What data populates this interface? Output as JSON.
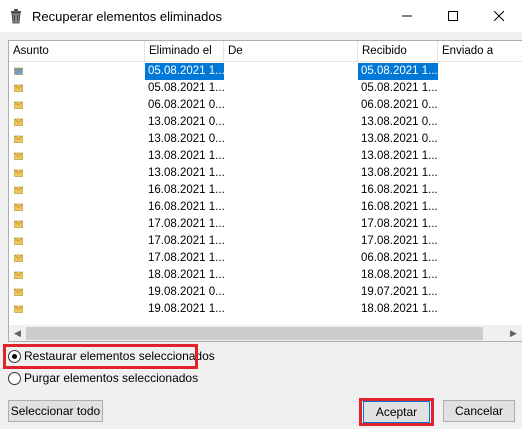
{
  "window": {
    "title": "Recuperar elementos eliminados"
  },
  "columns": [
    "Asunto",
    "Eliminado el",
    "De",
    "Recibido",
    "Enviado a"
  ],
  "rows": [
    {
      "eliminado": "05.08.2021 1...",
      "recibido": "05.08.2021 1...",
      "selected": true
    },
    {
      "eliminado": "05.08.2021 1...",
      "recibido": "05.08.2021 1..."
    },
    {
      "eliminado": "06.08.2021 0...",
      "recibido": "06.08.2021 0..."
    },
    {
      "eliminado": "13.08.2021 0...",
      "recibido": "13.08.2021 0..."
    },
    {
      "eliminado": "13.08.2021 0...",
      "recibido": "13.08.2021 0..."
    },
    {
      "eliminado": "13.08.2021 1...",
      "recibido": "13.08.2021 1..."
    },
    {
      "eliminado": "13.08.2021 1...",
      "recibido": "13.08.2021 1..."
    },
    {
      "eliminado": "16.08.2021 1...",
      "recibido": "16.08.2021 1..."
    },
    {
      "eliminado": "16.08.2021 1...",
      "recibido": "16.08.2021 1..."
    },
    {
      "eliminado": "17.08.2021 1...",
      "recibido": "17.08.2021 1..."
    },
    {
      "eliminado": "17.08.2021 1...",
      "recibido": "17.08.2021 1..."
    },
    {
      "eliminado": "17.08.2021 1...",
      "recibido": "06.08.2021 1..."
    },
    {
      "eliminado": "18.08.2021 1...",
      "recibido": "18.08.2021 1..."
    },
    {
      "eliminado": "19.08.2021 0...",
      "recibido": "19.07.2021 1..."
    },
    {
      "eliminado": "19.08.2021 1...",
      "recibido": "18.08.2021 1..."
    }
  ],
  "options": {
    "restore_label": "Restaurar elementos seleccionados",
    "purge_label": "Purgar elementos seleccionados",
    "selected": "restore"
  },
  "buttons": {
    "select_all": "Seleccionar todo",
    "ok": "Aceptar",
    "cancel": "Cancelar"
  },
  "colors": {
    "selection": "#0078d7",
    "highlight": "#e0202a",
    "folder": "#f1c75b"
  },
  "icons": {
    "app": "recycle-bin-icon",
    "row": "envelope-icon"
  }
}
